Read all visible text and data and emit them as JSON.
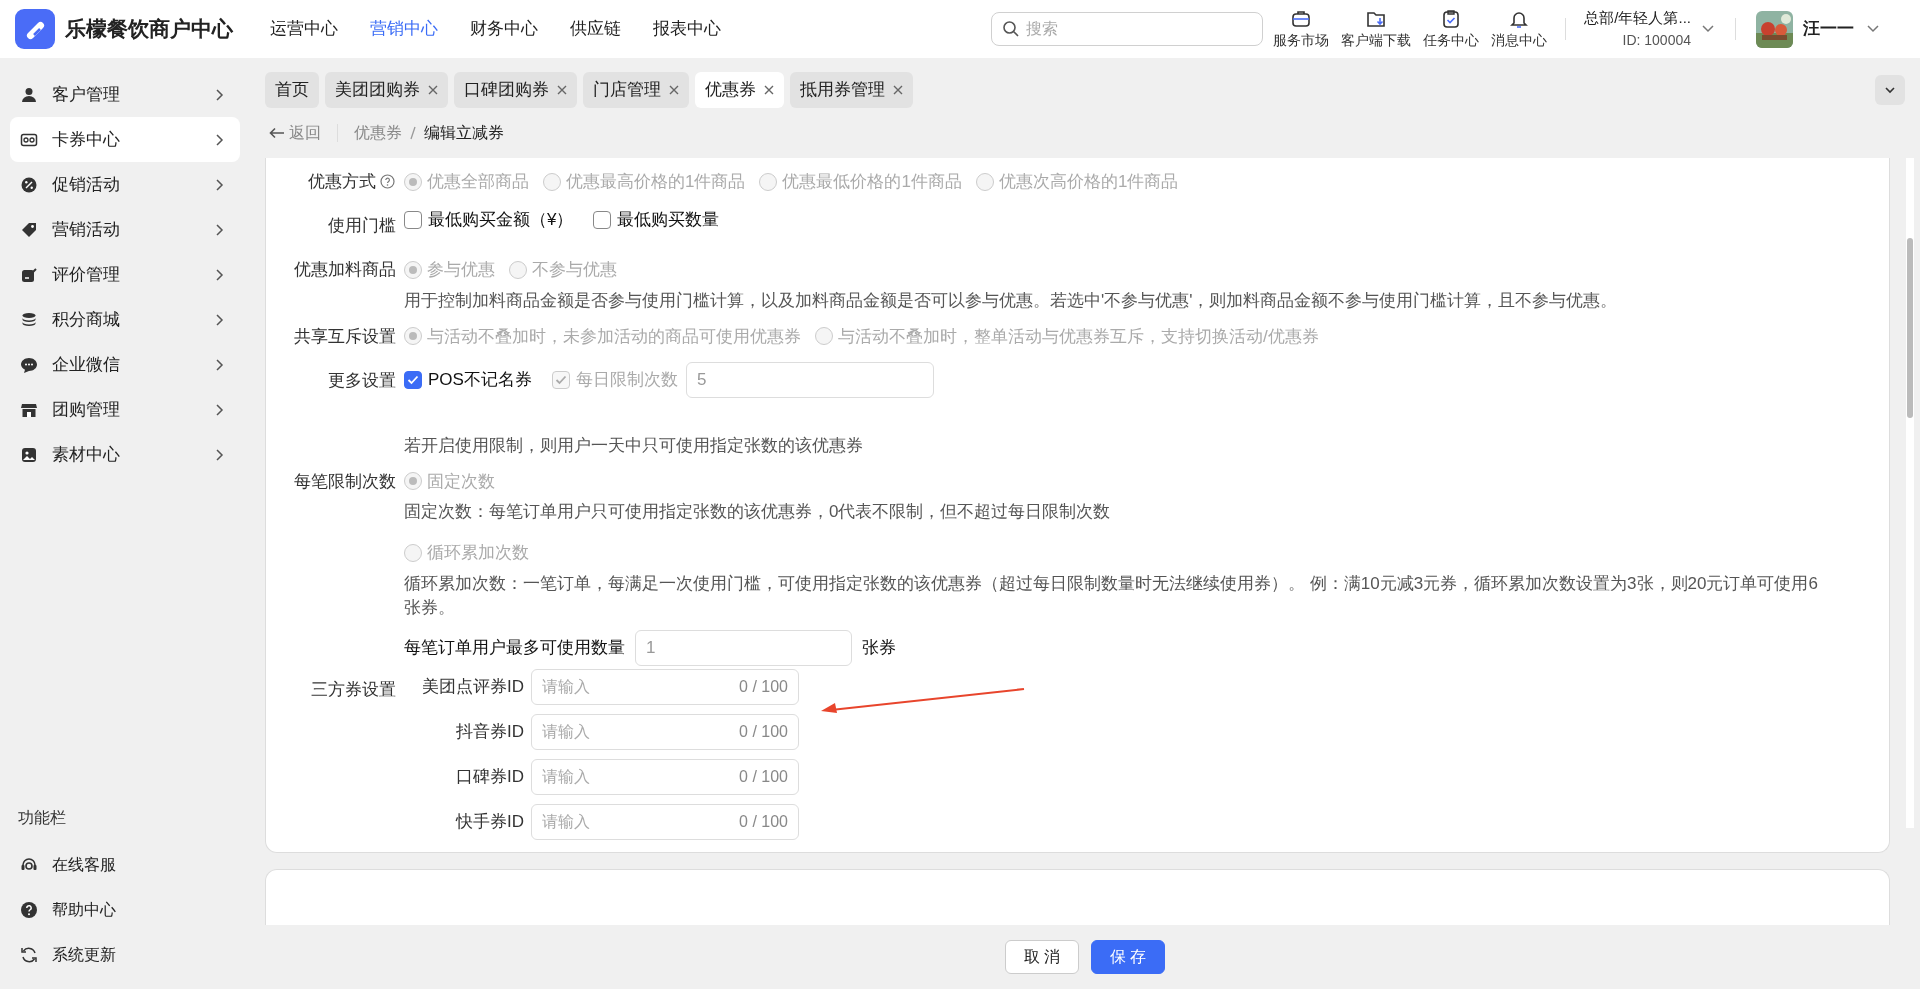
{
  "app": {
    "title": "乐檬餐饮商户中心"
  },
  "top_nav": [
    {
      "label": "运营中心",
      "selected": false
    },
    {
      "label": "营销中心",
      "selected": true
    },
    {
      "label": "财务中心",
      "selected": false
    },
    {
      "label": "供应链",
      "selected": false
    },
    {
      "label": "报表中心",
      "selected": false
    }
  ],
  "search": {
    "placeholder": "搜索"
  },
  "header_tools": [
    {
      "kind": "briefcase",
      "label": "服务市场"
    },
    {
      "kind": "folder",
      "label": "客户端下载"
    },
    {
      "kind": "clipboard",
      "label": "任务中心"
    },
    {
      "kind": "bell",
      "label": "消息中心"
    }
  ],
  "org": {
    "name": "总部/年轻人第...",
    "id": "ID: 100004"
  },
  "user": {
    "name": "汪一一"
  },
  "sidebar": {
    "items": [
      {
        "label": "客户管理",
        "selected": false
      },
      {
        "label": "卡券中心",
        "selected": true
      },
      {
        "label": "促销活动",
        "selected": false
      },
      {
        "label": "营销活动",
        "selected": false
      },
      {
        "label": "评价管理",
        "selected": false
      },
      {
        "label": "积分商城",
        "selected": false
      },
      {
        "label": "企业微信",
        "selected": false
      },
      {
        "label": "团购管理",
        "selected": false
      },
      {
        "label": "素材中心",
        "selected": false
      }
    ],
    "footer_title": "功能栏",
    "footer_items": [
      {
        "label": "在线客服"
      },
      {
        "label": "帮助中心"
      },
      {
        "label": "系统更新"
      }
    ]
  },
  "tabs": [
    {
      "label": "首页",
      "closable": false,
      "selected": false
    },
    {
      "label": "美团团购券",
      "closable": true,
      "selected": false
    },
    {
      "label": "口碑团购券",
      "closable": true,
      "selected": false
    },
    {
      "label": "门店管理",
      "closable": true,
      "selected": false
    },
    {
      "label": "优惠券",
      "closable": true,
      "selected": true
    },
    {
      "label": "抵用券管理",
      "closable": true,
      "selected": false
    }
  ],
  "breadcrumb": {
    "back": "返回",
    "items": [
      "优惠券",
      "编辑立减券"
    ]
  },
  "form": [
    {
      "kind": "radio",
      "label": "优惠方式",
      "help": true,
      "disabled": true,
      "options": [
        {
          "label": "优惠全部商品",
          "selected": true
        },
        {
          "label": "优惠最高价格的1件商品",
          "selected": false
        },
        {
          "label": "优惠最低价格的1件商品",
          "selected": false
        },
        {
          "label": "优惠次高价格的1件商品",
          "selected": false
        }
      ]
    },
    {
      "kind": "checkbox",
      "label": "使用门槛",
      "options": [
        {
          "label": "最低购买金额（¥）",
          "checked": false,
          "disabled": false
        },
        {
          "label": "最低购买数量",
          "checked": false,
          "disabled": false
        }
      ]
    },
    {
      "kind": "radio",
      "label": "优惠加料商品",
      "disabled": true,
      "options": [
        {
          "label": "参与优惠",
          "selected": true
        },
        {
          "label": "不参与优惠",
          "selected": false
        }
      ],
      "note": "用于控制加料商品金额是否参与使用门槛计算，以及加料商品金额是否可以参与优惠。若选中'不参与优惠'，则加料商品金额不参与使用门槛计算，且不参与优惠。"
    },
    {
      "kind": "radio",
      "label": "共享互斥设置",
      "disabled": true,
      "options": [
        {
          "label": "与活动不叠加时，未参加活动的商品可使用优惠券",
          "selected": true
        },
        {
          "label": "与活动不叠加时，整单活动与优惠券互斥，支持切换活动/优惠券",
          "selected": false
        }
      ]
    },
    {
      "kind": "checkbox",
      "label": "更多设置",
      "options": [
        {
          "label": "POS不记名券",
          "checked": true,
          "disabled": false
        },
        {
          "label": "每日限制次数",
          "checked": true,
          "disabled": true
        }
      ],
      "value": "5",
      "note": "若开启使用限制，则用户一天中只可使用指定张数的该优惠券"
    },
    {
      "kind": "limit",
      "label": "每笔限制次数",
      "disabled": true,
      "groups": [
        {
          "label": "固定次数",
          "selected": true,
          "note": "固定次数：每笔订单用户只可使用指定张数的该优惠券，0代表不限制，但不超过每日限制次数"
        },
        {
          "label": "循环累加次数",
          "selected": false,
          "note": "循环累加次数：一笔订单，每满足一次使用门槛，可使用指定张数的该优惠券（超过每日限制数量时无法继续使用券）。 例：满10元减3元券，循环累加次数设置为3张，则20元订单可使用6张券。"
        }
      ],
      "quantity": {
        "label": "每笔订单用户最多可使用数量",
        "value": "1",
        "unit": "张券"
      }
    },
    {
      "kind": "ids",
      "label": "三方券设置",
      "fields": [
        {
          "label": "美团点评券ID",
          "placeholder": "请输入",
          "count": "0 / 100"
        },
        {
          "label": "抖音券ID",
          "placeholder": "请输入",
          "count": "0 / 100"
        },
        {
          "label": "口碑券ID",
          "placeholder": "请输入",
          "count": "0 / 100"
        },
        {
          "label": "快手券ID",
          "placeholder": "请输入",
          "count": "0 / 100"
        }
      ]
    }
  ],
  "buttons": [
    {
      "kind": "default",
      "label": "取 消"
    },
    {
      "kind": "primary",
      "label": "保 存"
    }
  ]
}
